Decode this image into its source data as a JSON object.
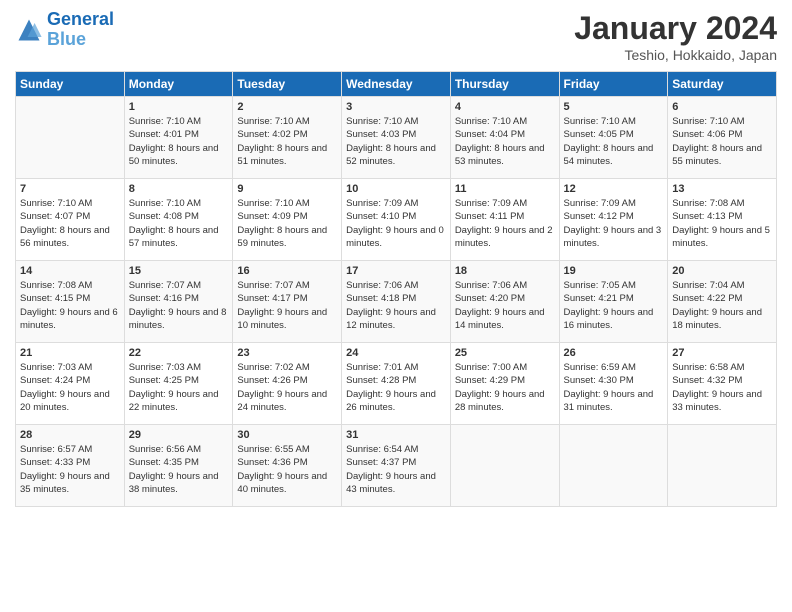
{
  "header": {
    "logo_line1": "General",
    "logo_line2": "Blue",
    "month": "January 2024",
    "location": "Teshio, Hokkaido, Japan"
  },
  "days_of_week": [
    "Sunday",
    "Monday",
    "Tuesday",
    "Wednesday",
    "Thursday",
    "Friday",
    "Saturday"
  ],
  "weeks": [
    [
      {
        "day": "",
        "sunrise": "",
        "sunset": "",
        "daylight": ""
      },
      {
        "day": "1",
        "sunrise": "Sunrise: 7:10 AM",
        "sunset": "Sunset: 4:01 PM",
        "daylight": "Daylight: 8 hours and 50 minutes."
      },
      {
        "day": "2",
        "sunrise": "Sunrise: 7:10 AM",
        "sunset": "Sunset: 4:02 PM",
        "daylight": "Daylight: 8 hours and 51 minutes."
      },
      {
        "day": "3",
        "sunrise": "Sunrise: 7:10 AM",
        "sunset": "Sunset: 4:03 PM",
        "daylight": "Daylight: 8 hours and 52 minutes."
      },
      {
        "day": "4",
        "sunrise": "Sunrise: 7:10 AM",
        "sunset": "Sunset: 4:04 PM",
        "daylight": "Daylight: 8 hours and 53 minutes."
      },
      {
        "day": "5",
        "sunrise": "Sunrise: 7:10 AM",
        "sunset": "Sunset: 4:05 PM",
        "daylight": "Daylight: 8 hours and 54 minutes."
      },
      {
        "day": "6",
        "sunrise": "Sunrise: 7:10 AM",
        "sunset": "Sunset: 4:06 PM",
        "daylight": "Daylight: 8 hours and 55 minutes."
      }
    ],
    [
      {
        "day": "7",
        "sunrise": "Sunrise: 7:10 AM",
        "sunset": "Sunset: 4:07 PM",
        "daylight": "Daylight: 8 hours and 56 minutes."
      },
      {
        "day": "8",
        "sunrise": "Sunrise: 7:10 AM",
        "sunset": "Sunset: 4:08 PM",
        "daylight": "Daylight: 8 hours and 57 minutes."
      },
      {
        "day": "9",
        "sunrise": "Sunrise: 7:10 AM",
        "sunset": "Sunset: 4:09 PM",
        "daylight": "Daylight: 8 hours and 59 minutes."
      },
      {
        "day": "10",
        "sunrise": "Sunrise: 7:09 AM",
        "sunset": "Sunset: 4:10 PM",
        "daylight": "Daylight: 9 hours and 0 minutes."
      },
      {
        "day": "11",
        "sunrise": "Sunrise: 7:09 AM",
        "sunset": "Sunset: 4:11 PM",
        "daylight": "Daylight: 9 hours and 2 minutes."
      },
      {
        "day": "12",
        "sunrise": "Sunrise: 7:09 AM",
        "sunset": "Sunset: 4:12 PM",
        "daylight": "Daylight: 9 hours and 3 minutes."
      },
      {
        "day": "13",
        "sunrise": "Sunrise: 7:08 AM",
        "sunset": "Sunset: 4:13 PM",
        "daylight": "Daylight: 9 hours and 5 minutes."
      }
    ],
    [
      {
        "day": "14",
        "sunrise": "Sunrise: 7:08 AM",
        "sunset": "Sunset: 4:15 PM",
        "daylight": "Daylight: 9 hours and 6 minutes."
      },
      {
        "day": "15",
        "sunrise": "Sunrise: 7:07 AM",
        "sunset": "Sunset: 4:16 PM",
        "daylight": "Daylight: 9 hours and 8 minutes."
      },
      {
        "day": "16",
        "sunrise": "Sunrise: 7:07 AM",
        "sunset": "Sunset: 4:17 PM",
        "daylight": "Daylight: 9 hours and 10 minutes."
      },
      {
        "day": "17",
        "sunrise": "Sunrise: 7:06 AM",
        "sunset": "Sunset: 4:18 PM",
        "daylight": "Daylight: 9 hours and 12 minutes."
      },
      {
        "day": "18",
        "sunrise": "Sunrise: 7:06 AM",
        "sunset": "Sunset: 4:20 PM",
        "daylight": "Daylight: 9 hours and 14 minutes."
      },
      {
        "day": "19",
        "sunrise": "Sunrise: 7:05 AM",
        "sunset": "Sunset: 4:21 PM",
        "daylight": "Daylight: 9 hours and 16 minutes."
      },
      {
        "day": "20",
        "sunrise": "Sunrise: 7:04 AM",
        "sunset": "Sunset: 4:22 PM",
        "daylight": "Daylight: 9 hours and 18 minutes."
      }
    ],
    [
      {
        "day": "21",
        "sunrise": "Sunrise: 7:03 AM",
        "sunset": "Sunset: 4:24 PM",
        "daylight": "Daylight: 9 hours and 20 minutes."
      },
      {
        "day": "22",
        "sunrise": "Sunrise: 7:03 AM",
        "sunset": "Sunset: 4:25 PM",
        "daylight": "Daylight: 9 hours and 22 minutes."
      },
      {
        "day": "23",
        "sunrise": "Sunrise: 7:02 AM",
        "sunset": "Sunset: 4:26 PM",
        "daylight": "Daylight: 9 hours and 24 minutes."
      },
      {
        "day": "24",
        "sunrise": "Sunrise: 7:01 AM",
        "sunset": "Sunset: 4:28 PM",
        "daylight": "Daylight: 9 hours and 26 minutes."
      },
      {
        "day": "25",
        "sunrise": "Sunrise: 7:00 AM",
        "sunset": "Sunset: 4:29 PM",
        "daylight": "Daylight: 9 hours and 28 minutes."
      },
      {
        "day": "26",
        "sunrise": "Sunrise: 6:59 AM",
        "sunset": "Sunset: 4:30 PM",
        "daylight": "Daylight: 9 hours and 31 minutes."
      },
      {
        "day": "27",
        "sunrise": "Sunrise: 6:58 AM",
        "sunset": "Sunset: 4:32 PM",
        "daylight": "Daylight: 9 hours and 33 minutes."
      }
    ],
    [
      {
        "day": "28",
        "sunrise": "Sunrise: 6:57 AM",
        "sunset": "Sunset: 4:33 PM",
        "daylight": "Daylight: 9 hours and 35 minutes."
      },
      {
        "day": "29",
        "sunrise": "Sunrise: 6:56 AM",
        "sunset": "Sunset: 4:35 PM",
        "daylight": "Daylight: 9 hours and 38 minutes."
      },
      {
        "day": "30",
        "sunrise": "Sunrise: 6:55 AM",
        "sunset": "Sunset: 4:36 PM",
        "daylight": "Daylight: 9 hours and 40 minutes."
      },
      {
        "day": "31",
        "sunrise": "Sunrise: 6:54 AM",
        "sunset": "Sunset: 4:37 PM",
        "daylight": "Daylight: 9 hours and 43 minutes."
      },
      {
        "day": "",
        "sunrise": "",
        "sunset": "",
        "daylight": ""
      },
      {
        "day": "",
        "sunrise": "",
        "sunset": "",
        "daylight": ""
      },
      {
        "day": "",
        "sunrise": "",
        "sunset": "",
        "daylight": ""
      }
    ]
  ]
}
